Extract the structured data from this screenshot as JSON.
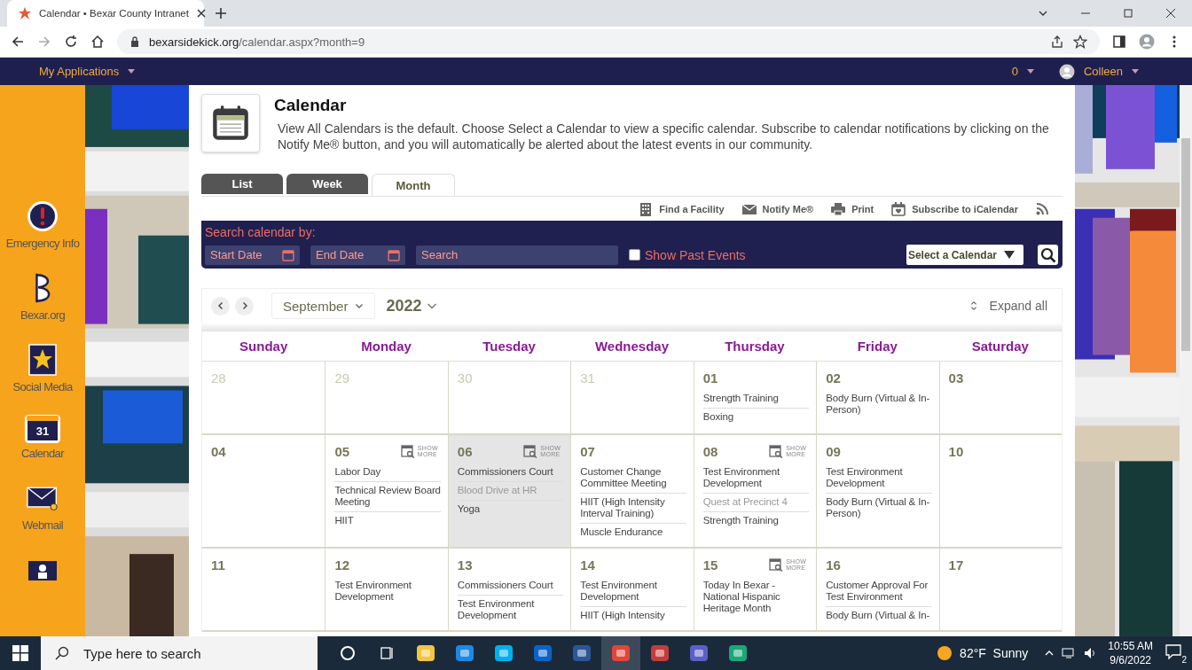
{
  "browser": {
    "tab_title": "Calendar • Bexar County Intranet",
    "url_domain": "bexarsidekick.org",
    "url_path": "/calendar.aspx?month=9"
  },
  "nav": {
    "menu": "My Applications",
    "count": "0",
    "user": "Colleen"
  },
  "sidebar": {
    "items": [
      {
        "kind": "alert",
        "label": "Emergency Info"
      },
      {
        "kind": "logo",
        "label": "Bexar.org"
      },
      {
        "kind": "star",
        "label": "Social Media"
      },
      {
        "kind": "calendar",
        "label": "Calendar",
        "icon_text": "31"
      },
      {
        "kind": "mail",
        "label": "Webmail"
      },
      {
        "kind": "person"
      }
    ]
  },
  "page": {
    "title": "Calendar",
    "description": "View All Calendars is the default. Choose Select a Calendar to view a specific calendar. Subscribe to calendar notifications by clicking on the Notify Me® button, and you will automatically be alerted about the latest events in our community."
  },
  "tabs": [
    {
      "label": "List",
      "selected": false
    },
    {
      "label": "Week",
      "selected": false
    },
    {
      "label": "Month",
      "selected": true
    }
  ],
  "tools": [
    {
      "kind": "facility",
      "label": "Find a Facility"
    },
    {
      "kind": "mail",
      "label": "Notify Me®"
    },
    {
      "kind": "print",
      "label": "Print"
    },
    {
      "kind": "ical",
      "label": "Subscribe to iCalendar"
    },
    {
      "kind": "rss"
    }
  ],
  "search": {
    "heading": "Search calendar by:",
    "start_placeholder": "Start Date",
    "end_placeholder": "End Date",
    "search_placeholder": "Search",
    "show_past": {
      "label": "Show Past Events",
      "checked": false
    },
    "select": "Select a Calendar"
  },
  "month_nav": {
    "month": "September",
    "year": "2022",
    "expand": "Expand all"
  },
  "calendar": {
    "days": [
      "Sunday",
      "Monday",
      "Tuesday",
      "Wednesday",
      "Thursday",
      "Friday",
      "Saturday"
    ],
    "weeks": [
      [
        {
          "day": "28",
          "other_month": true,
          "today": false
        },
        {
          "day": "29",
          "other_month": true,
          "today": false
        },
        {
          "day": "30",
          "other_month": true,
          "today": false
        },
        {
          "day": "31",
          "other_month": true,
          "today": false
        },
        {
          "day": "01",
          "other_month": false,
          "today": false,
          "events": [
            {
              "title": "Strength Training",
              "muted": false
            },
            {
              "title": "Boxing",
              "muted": false
            }
          ]
        },
        {
          "day": "02",
          "other_month": false,
          "today": false,
          "events": [
            {
              "title": "Body Burn (Virtual & In-Person)",
              "muted": false
            }
          ]
        },
        {
          "day": "03",
          "other_month": false,
          "today": false
        }
      ],
      [
        {
          "day": "04",
          "other_month": false,
          "today": false
        },
        {
          "day": "05",
          "other_month": false,
          "today": false,
          "show_more": "SHOW MORE",
          "events": [
            {
              "title": "Labor Day",
              "muted": false
            },
            {
              "title": "Technical Review Board Meeting",
              "muted": false
            },
            {
              "title": "HIIT",
              "muted": false
            }
          ]
        },
        {
          "day": "06",
          "other_month": false,
          "today": true,
          "show_more": "SHOW MORE",
          "events": [
            {
              "title": "Commissioners Court",
              "muted": false
            },
            {
              "title": "Blood Drive at HR",
              "muted": true
            },
            {
              "title": "Yoga",
              "muted": false
            }
          ]
        },
        {
          "day": "07",
          "other_month": false,
          "today": false,
          "events": [
            {
              "title": "Customer Change Committee Meeting",
              "muted": false
            },
            {
              "title": "HIIT (High Intensity Interval Training)",
              "muted": false
            },
            {
              "title": "Muscle Endurance",
              "muted": false
            }
          ]
        },
        {
          "day": "08",
          "other_month": false,
          "today": false,
          "show_more": "SHOW MORE",
          "events": [
            {
              "title": "Test Environment Development",
              "muted": false
            },
            {
              "title": "Quest at Precinct 4",
              "muted": true
            },
            {
              "title": "Strength Training",
              "muted": false
            }
          ]
        },
        {
          "day": "09",
          "other_month": false,
          "today": false,
          "events": [
            {
              "title": "Test Environment Development",
              "muted": false
            },
            {
              "title": "Body Burn (Virtual & In-Person)",
              "muted": false
            }
          ]
        },
        {
          "day": "10",
          "other_month": false,
          "today": false
        }
      ],
      [
        {
          "day": "11",
          "other_month": false,
          "today": false
        },
        {
          "day": "12",
          "other_month": false,
          "today": false,
          "events": [
            {
              "title": "Test Environment Development",
              "muted": false
            }
          ]
        },
        {
          "day": "13",
          "other_month": false,
          "today": false,
          "events": [
            {
              "title": "Commissioners Court",
              "muted": false
            },
            {
              "title": "Test Environment Development",
              "muted": false
            }
          ]
        },
        {
          "day": "14",
          "other_month": false,
          "today": false,
          "events": [
            {
              "title": "Test Environment Development",
              "muted": false
            },
            {
              "title": "HIIT (High Intensity",
              "muted": false
            }
          ]
        },
        {
          "day": "15",
          "other_month": false,
          "today": false,
          "show_more": "SHOW MORE",
          "events": [
            {
              "title": "Today In Bexar - National Hispanic Heritage Month",
              "muted": false
            }
          ]
        },
        {
          "day": "16",
          "other_month": false,
          "today": false,
          "events": [
            {
              "title": "Customer Approval For Test Environment",
              "muted": false
            },
            {
              "title": "Body Burn (Virtual & In-",
              "muted": false
            }
          ]
        },
        {
          "day": "17",
          "other_month": false,
          "today": false
        }
      ]
    ]
  },
  "taskbar": {
    "search_placeholder": "Type here to search",
    "weather": "82°F  Sunny",
    "time": "10:55 AM",
    "date": "9/6/2022",
    "notifications": "2"
  }
}
